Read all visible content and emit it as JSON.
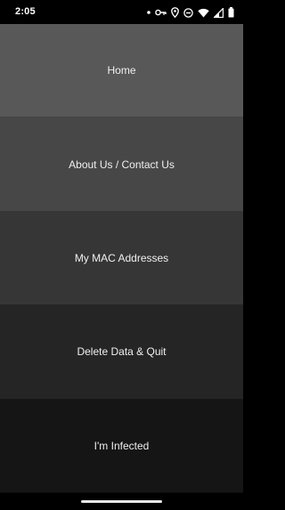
{
  "status_bar": {
    "time": "2:05",
    "icons": [
      "notification-dot-icon",
      "vpn-key-icon",
      "location-icon",
      "do-not-disturb-icon",
      "wifi-icon",
      "cell-signal-icon",
      "battery-icon"
    ]
  },
  "menu": {
    "items": [
      {
        "label": "Home"
      },
      {
        "label": "About Us / Contact Us"
      },
      {
        "label": "My MAC Addresses"
      },
      {
        "label": "Delete Data & Quit"
      },
      {
        "label": "I'm Infected"
      }
    ]
  },
  "colors": {
    "item_1": "#585858",
    "item_2": "#474747",
    "item_3": "#363636",
    "item_4": "#252525",
    "item_5": "#151515"
  }
}
